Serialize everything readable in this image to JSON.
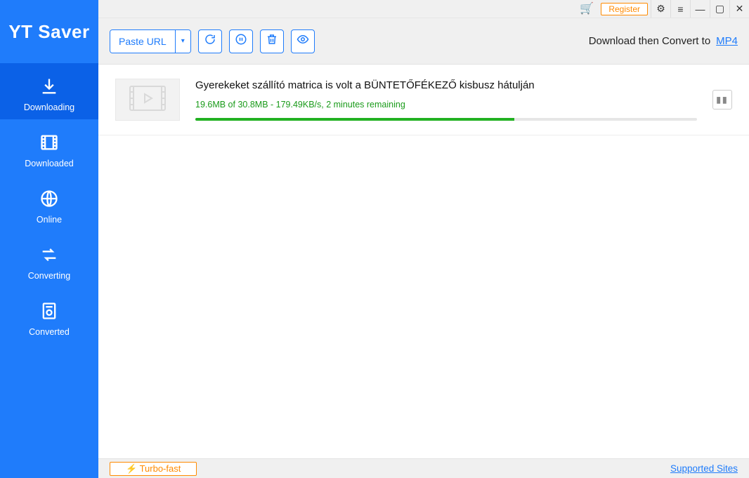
{
  "app": {
    "name": "YT Saver"
  },
  "sidebar": {
    "items": [
      {
        "label": "Downloading",
        "active": true
      },
      {
        "label": "Downloaded"
      },
      {
        "label": "Online"
      },
      {
        "label": "Converting"
      },
      {
        "label": "Converted"
      }
    ]
  },
  "titlebar": {
    "register_label": "Register"
  },
  "toolbar": {
    "paste_label": "Paste URL",
    "convert_text": "Download then Convert to",
    "convert_format": "MP4"
  },
  "downloads": [
    {
      "title": "Gyerekeket szállító matrica is volt a BÜNTETŐFÉKEZŐ kisbusz hátulján",
      "status": "19.6MB of 30.8MB -  179.49KB/s, 2 minutes remaining",
      "progress_percent": 63.6
    }
  ],
  "footer": {
    "turbo_label": "Turbo-fast",
    "supported_label": "Supported Sites"
  }
}
